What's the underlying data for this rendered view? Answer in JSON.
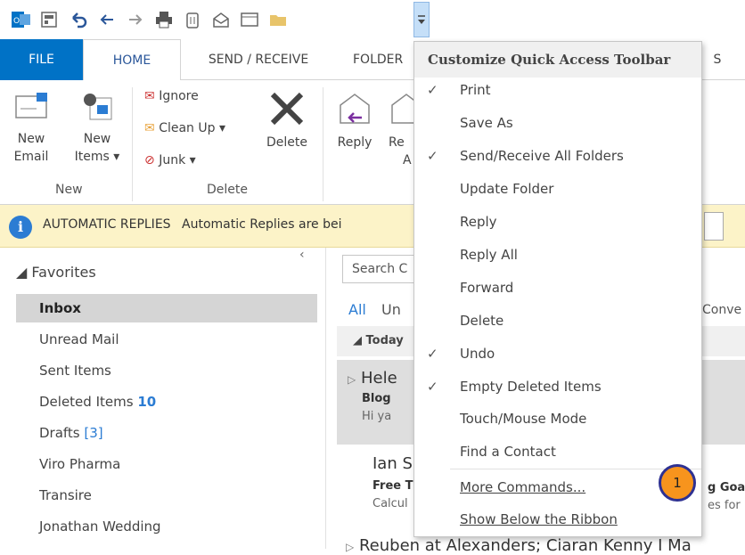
{
  "tabs": {
    "file": "FILE",
    "home": "HOME",
    "send_receive": "SEND / RECEIVE",
    "folder": "FOLDER",
    "view_partial": "S"
  },
  "ribbon": {
    "new_email": [
      "New",
      "Email"
    ],
    "new_items": [
      "New",
      "Items"
    ],
    "ignore": "Ignore",
    "clean_up": "Clean Up",
    "junk": "Junk",
    "delete": "Delete",
    "reply": "Reply",
    "reply_all_partial": [
      "Re",
      "A"
    ],
    "group_new": "New",
    "group_delete": "Delete"
  },
  "infobar": {
    "title": "AUTOMATIC REPLIES",
    "text": "Automatic Replies are bei"
  },
  "folders": {
    "header": "Favorites",
    "items": [
      {
        "name": "Inbox",
        "count": ""
      },
      {
        "name": "Unread Mail",
        "count": ""
      },
      {
        "name": "Sent Items",
        "count": ""
      },
      {
        "name": "Deleted Items",
        "count": "10"
      },
      {
        "name": "Drafts",
        "count": "[3]"
      },
      {
        "name": "Viro Pharma",
        "count": ""
      },
      {
        "name": "Transire",
        "count": ""
      },
      {
        "name": "Jonathan Wedding",
        "count": ""
      }
    ]
  },
  "messages": {
    "search_placeholder": "Search C",
    "filter_all": "All",
    "filter_unread_partial": "Un",
    "conversations_partial": "Conve",
    "group_today": "Today",
    "items": [
      {
        "sender": "Hele",
        "subject": "Blog",
        "preview": "Hi ya"
      },
      {
        "sender": "Ian S",
        "subject": "Free T",
        "preview": "Calcul",
        "right_subject": "g Goa",
        "right_preview": "es for"
      }
    ],
    "bottom_partial": "Reuben at Alexanders; Ciaran Kenny I Ma"
  },
  "menu": {
    "title": "Customize Quick Access Toolbar",
    "items": [
      {
        "label": "Print",
        "checked": true
      },
      {
        "label": "Save As",
        "checked": false
      },
      {
        "label": "Send/Receive All Folders",
        "checked": true
      },
      {
        "label": "Update Folder",
        "checked": false
      },
      {
        "label": "Reply",
        "checked": false
      },
      {
        "label": "Reply All",
        "checked": false
      },
      {
        "label": "Forward",
        "checked": false
      },
      {
        "label": "Delete",
        "checked": false
      },
      {
        "label": "Undo",
        "checked": true
      },
      {
        "label": "Empty Deleted Items",
        "checked": true
      },
      {
        "label": "Touch/Mouse Mode",
        "checked": false
      },
      {
        "label": "Find a Contact",
        "checked": false
      },
      {
        "label": "More Commands...",
        "checked": false
      },
      {
        "label": "Show Below the Ribbon",
        "checked": false
      }
    ],
    "check_glyph": "✓"
  },
  "callout": "1",
  "colors": {
    "accent": "#0072c6",
    "infobar": "#fcf3c8",
    "callout": "#f7941d"
  }
}
